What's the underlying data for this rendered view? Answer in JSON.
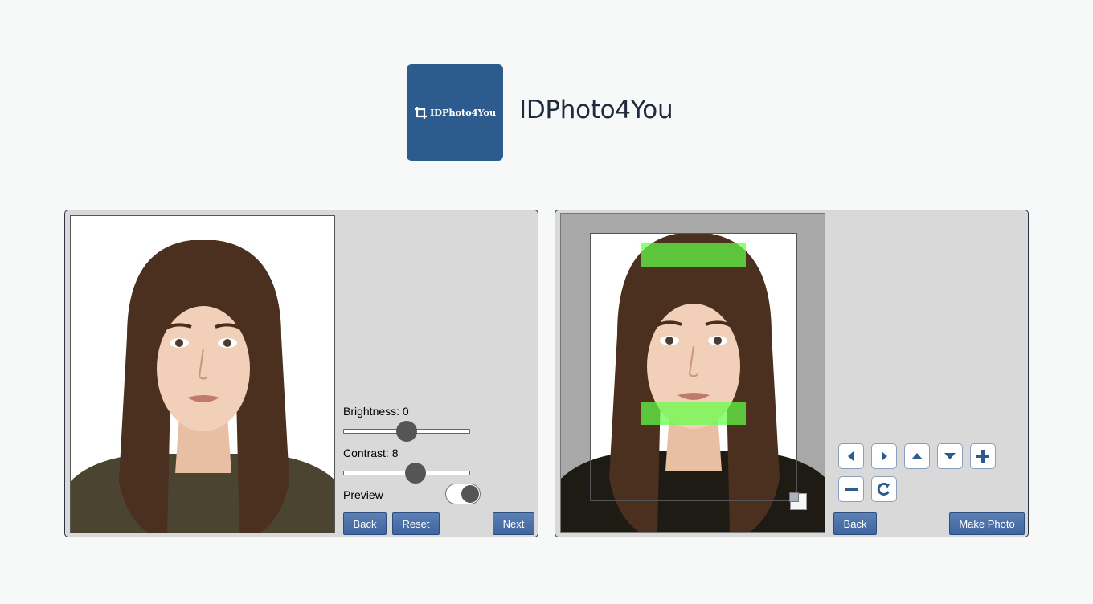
{
  "brand": {
    "logo_text": "IDPhoto4You",
    "name": "IDPhoto4You",
    "color": "#2e5b8e"
  },
  "adjust_panel": {
    "brightness_label": "Brightness: 0",
    "brightness_value": 0,
    "contrast_label": "Contrast: 8",
    "contrast_value": 8,
    "preview_label": "Preview",
    "preview_on": true,
    "back_label": "Back",
    "reset_label": "Reset",
    "next_label": "Next"
  },
  "crop_panel": {
    "nav_icons": [
      "arrow-left-icon",
      "arrow-right-icon",
      "arrow-up-icon",
      "arrow-down-icon",
      "zoom-in-icon",
      "zoom-out-icon",
      "rotate-icon"
    ],
    "back_label": "Back",
    "make_photo_label": "Make Photo",
    "guide_color": "#64ff46"
  },
  "colors": {
    "button": "#4a6fa8",
    "panel_bg": "#d9d9d9"
  }
}
